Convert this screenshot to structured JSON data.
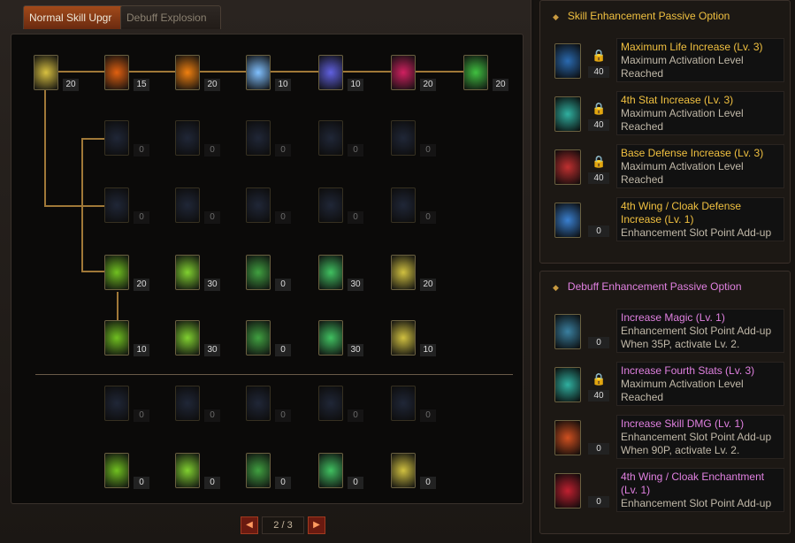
{
  "tabs": [
    {
      "label": "Normal Skill Upgr",
      "active": true
    },
    {
      "label": "Debuff Explosion",
      "active": false
    }
  ],
  "skill_grid": {
    "rows": [
      {
        "levels": [
          "20",
          "15",
          "20",
          "10",
          "10",
          "20",
          "20"
        ],
        "dim": false
      },
      {
        "levels": [
          "0",
          "0",
          "0",
          "0",
          "0"
        ],
        "dim": true
      },
      {
        "levels": [
          "0",
          "0",
          "0",
          "0",
          "0"
        ],
        "dim": true
      },
      {
        "levels": [
          "20",
          "30",
          "0",
          "30",
          "20"
        ],
        "dim": false
      },
      {
        "levels": [
          "10",
          "30",
          "0",
          "30",
          "10"
        ],
        "dim": false
      },
      {
        "levels": [
          "0",
          "0",
          "0",
          "0",
          "0"
        ],
        "dim": true
      },
      {
        "levels": [
          "0",
          "0",
          "0",
          "0",
          "0"
        ],
        "dim": false
      }
    ]
  },
  "pager": {
    "prev": "◀",
    "page": "2 / 3",
    "next": "▶"
  },
  "skill_section": {
    "title": "Skill Enhancement Passive Option",
    "items": [
      {
        "title": "Maximum Life Increase (Lv. 3)",
        "desc": "Maximum Activation Level Reached",
        "level": "40",
        "locked": true,
        "icon_color": "#2a6ab0"
      },
      {
        "title": "4th Stat Increase (Lv. 3)",
        "desc": "Maximum Activation Level Reached",
        "level": "40",
        "locked": true,
        "icon_color": "#30b0a0"
      },
      {
        "title": "Base Defense Increase (Lv. 3)",
        "desc": "Maximum Activation Level Reached",
        "level": "40",
        "locked": true,
        "icon_color": "#c03030"
      },
      {
        "title": "4th Wing / Cloak Defense Increase (Lv. 1)",
        "desc": "Enhancement Slot Point Add-up",
        "level": "0",
        "locked": false,
        "icon_color": "#3a80d0"
      }
    ]
  },
  "debuff_section": {
    "title": "Debuff Enhancement Passive Option",
    "items": [
      {
        "title": "Increase Magic (Lv. 1)",
        "desc": "Enhancement Slot Point Add-up When 35P, activate Lv. 2.",
        "level": "0",
        "locked": false,
        "icon_color": "#3a80a0"
      },
      {
        "title": "Increase Fourth Stats (Lv. 3)",
        "desc": "Maximum Activation Level Reached",
        "level": "40",
        "locked": true,
        "icon_color": "#30b0a0"
      },
      {
        "title": "Increase Skill DMG (Lv. 1)",
        "desc": "Enhancement Slot Point Add-up When 90P, activate Lv. 2.",
        "level": "0",
        "locked": false,
        "icon_color": "#d05020"
      },
      {
        "title": "4th Wing / Cloak Enchantment (Lv. 1)",
        "desc": "Enhancement Slot Point Add-up",
        "level": "0",
        "locked": false,
        "icon_color": "#c02030"
      }
    ]
  },
  "colors": {
    "gold": "#f0c040",
    "pink": "#e080e0",
    "active_tab": "#a24a1a"
  }
}
